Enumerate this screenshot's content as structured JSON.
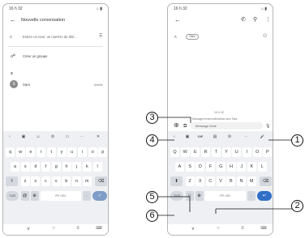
{
  "left_screen": {
    "status_time": "16 h 32",
    "status_icons": "⌂ ▮",
    "back_icon": "←",
    "title": "Nouvelle conversation",
    "to_label": "À",
    "to_placeholder": "Entrez un nom, un numéro de télé...",
    "dialpad_icon": "⠿",
    "create_group_icon": "☍",
    "create_group_label": "Créer un groupe",
    "section_letter": "S",
    "contact_initial": "S",
    "contact_name": "Sara",
    "contact_type": "Mobile"
  },
  "right_screen": {
    "status_time": "16 h 32",
    "status_icons": "⌂ ▮",
    "back_icon": "←",
    "call_icon": "✆",
    "search_icon": "⚲",
    "more_icon": "⋮",
    "to_label": "À",
    "recipient_chip": "Sara",
    "add_person_icon": "⚇",
    "timestamp": "16 h 32",
    "rich_notice": "Messages texte/multimédias avec Sara",
    "add_icon": "⊕",
    "attach_icon": "⧉",
    "message_placeholder": "Message texte",
    "mic_icon": "🎙"
  },
  "keyboard_left": {
    "toolbar": [
      "‹",
      "▣",
      "☺",
      "⚙",
      "▭",
      "⋯",
      "✕"
    ],
    "row1": [
      "q",
      "w",
      "e",
      "r",
      "t",
      "y",
      "u",
      "i",
      "o",
      "p"
    ],
    "row2": [
      "a",
      "s",
      "d",
      "f",
      "g",
      "h",
      "j",
      "k",
      "l"
    ],
    "row3": [
      "⇧",
      "z",
      "x",
      "c",
      "v",
      "b",
      "n",
      "m",
      "⌫"
    ],
    "row4": [
      "?123",
      "@",
      "⊕",
      "FR • EN",
      ".",
      "✓"
    ]
  },
  "keyboard_right": {
    "toolbar": [
      "‹",
      "▣",
      "GIF",
      "▤",
      "⚙",
      "⋯",
      "🎤"
    ],
    "row1": [
      "Q",
      "W",
      "E",
      "R",
      "T",
      "Y",
      "U",
      "I",
      "O",
      "P"
    ],
    "row2": [
      "A",
      "S",
      "D",
      "F",
      "G",
      "H",
      "J",
      "K",
      "L"
    ],
    "row3": [
      "⬆",
      "Z",
      "X",
      "C",
      "V",
      "B",
      "N",
      "M",
      "⌫"
    ],
    "row4": [
      "?123",
      "☺",
      "⊕",
      "FR • EN",
      ".",
      "↵"
    ]
  },
  "nav_left": [
    "∨",
    "○",
    "≡",
    "⌨"
  ],
  "nav_right": [
    "∨",
    "○",
    "≡",
    "⌨"
  ],
  "callouts": [
    "1",
    "2",
    "3",
    "4",
    "5",
    "6"
  ]
}
